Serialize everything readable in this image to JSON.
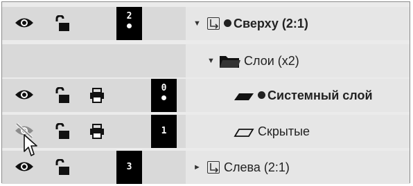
{
  "rows": [
    {
      "badge": "2",
      "badge_dot": true,
      "expander": "▼",
      "label": "Сверху (2:1)",
      "bold": true,
      "dot": true,
      "kind": "view",
      "visible": true,
      "printer": false
    },
    {
      "expander": "▼",
      "label": "Слои (x2)",
      "bold": false,
      "dot": false,
      "kind": "folder"
    },
    {
      "badge": "0",
      "badge_dot": true,
      "label": "Системный слой",
      "bold": true,
      "dot": true,
      "kind": "layer-filled",
      "visible": true,
      "printer": true
    },
    {
      "badge": "1",
      "badge_dot": false,
      "label": "Скрытые",
      "bold": false,
      "dot": false,
      "kind": "layer-outline",
      "visible": false,
      "printer": true
    },
    {
      "badge": "3",
      "badge_dot": false,
      "expander": "►",
      "label": "Слева (2:1)",
      "bold": false,
      "dot": false,
      "kind": "view",
      "visible": true,
      "printer": false
    }
  ],
  "colors": {
    "left_bg": "#d9d9d9",
    "right_bg": "#e6e6e6",
    "icon": "#111111",
    "hidden_icon": "#8c8c8c",
    "badge": "#000000"
  }
}
